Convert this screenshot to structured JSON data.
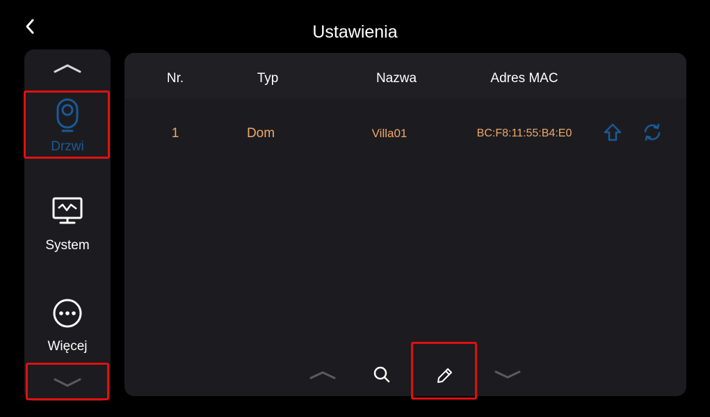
{
  "header": {
    "title": "Ustawienia",
    "back_icon": "chevron-left-icon"
  },
  "sidebar": {
    "items": [
      {
        "label": "Drzwi",
        "icon": "doorbell-camera-icon",
        "active": true,
        "color": "#1a5a96"
      },
      {
        "label": "System",
        "icon": "monitor-icon",
        "active": false,
        "color": "#ffffff"
      },
      {
        "label": "Więcej",
        "icon": "more-dots-icon",
        "active": false,
        "color": "#ffffff"
      }
    ]
  },
  "table": {
    "columns": [
      "Nr.",
      "Typ",
      "Nazwa",
      "Adres MAC"
    ],
    "rows": [
      {
        "nr": "1",
        "typ": "Dom",
        "nazwa": "Villa01",
        "mac": "BC:F8:11:55:B4:E0",
        "actions": [
          "upload-icon",
          "refresh-icon"
        ]
      }
    ]
  },
  "footer": {
    "buttons": [
      "page-up-icon",
      "search-icon",
      "edit-icon",
      "page-down-icon"
    ]
  },
  "colors": {
    "accent_blue": "#1a5a96",
    "value_orange": "#f0a868",
    "highlight_red": "#e01010",
    "panel": "#1c1c20"
  }
}
